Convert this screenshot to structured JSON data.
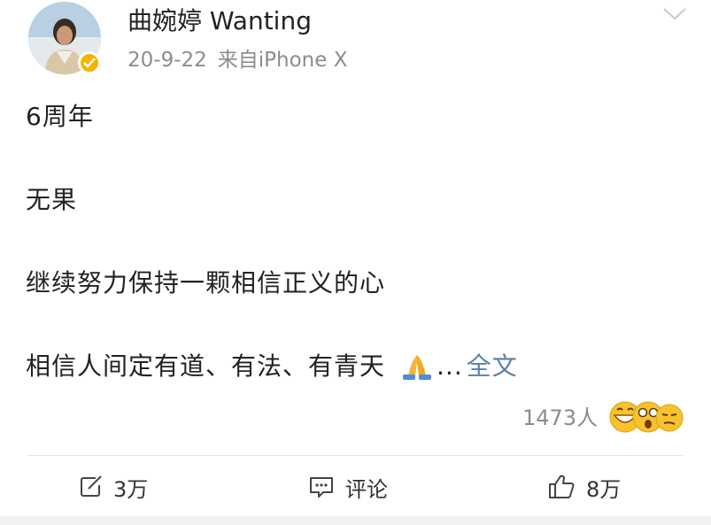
{
  "post": {
    "author": {
      "name": "曲婉婷 Wanting",
      "avatar_icon": "portrait-photo",
      "verified_color": "#f5b400"
    },
    "date": "20-9-22",
    "source": "来自iPhone X",
    "lines": [
      "6周年",
      "无果",
      "继续努力保持一颗相信正义的心",
      "相信人间定有道、有法、有青天"
    ],
    "ellipsis": "...",
    "full_text_label": "全文",
    "reaction_count": "1473人",
    "reaction_emojis": [
      "grin-icon",
      "astonished-icon",
      "smirk-icon"
    ]
  },
  "actions": {
    "repost": "3万",
    "comment": "评论",
    "like": "8万"
  },
  "colors": {
    "text": "#222222",
    "meta": "#8c8c8c",
    "link": "#5a7ea8"
  }
}
